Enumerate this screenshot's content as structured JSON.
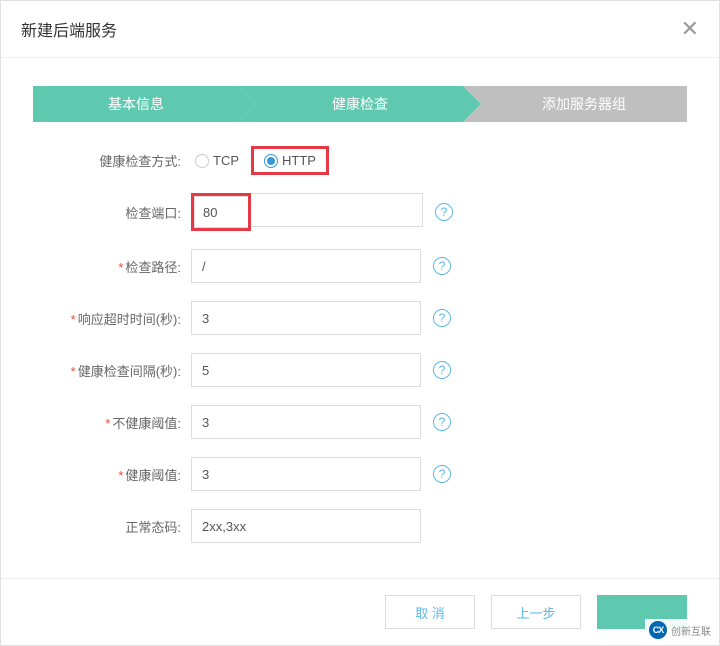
{
  "modal": {
    "title": "新建后端服务"
  },
  "steps": {
    "step1": "基本信息",
    "step2": "健康检查",
    "step3": "添加服务器组"
  },
  "form": {
    "check_method": {
      "label": "健康检查方式:",
      "options": {
        "tcp": "TCP",
        "http": "HTTP"
      }
    },
    "check_port": {
      "label": "检查端口:",
      "value": "80"
    },
    "check_path": {
      "label": "检查路径:",
      "value": "/"
    },
    "response_timeout": {
      "label": "响应超时时间(秒):",
      "value": "3"
    },
    "check_interval": {
      "label": "健康检查间隔(秒):",
      "value": "5"
    },
    "unhealthy_threshold": {
      "label": "不健康阈值:",
      "value": "3"
    },
    "healthy_threshold": {
      "label": "健康阈值:",
      "value": "3"
    },
    "status_code": {
      "label": "正常态码:",
      "value": "2xx,3xx"
    }
  },
  "footer": {
    "cancel": "取 消",
    "prev": "上一步",
    "next": ""
  },
  "watermark": {
    "logo": "CX",
    "text": "创新互联"
  }
}
